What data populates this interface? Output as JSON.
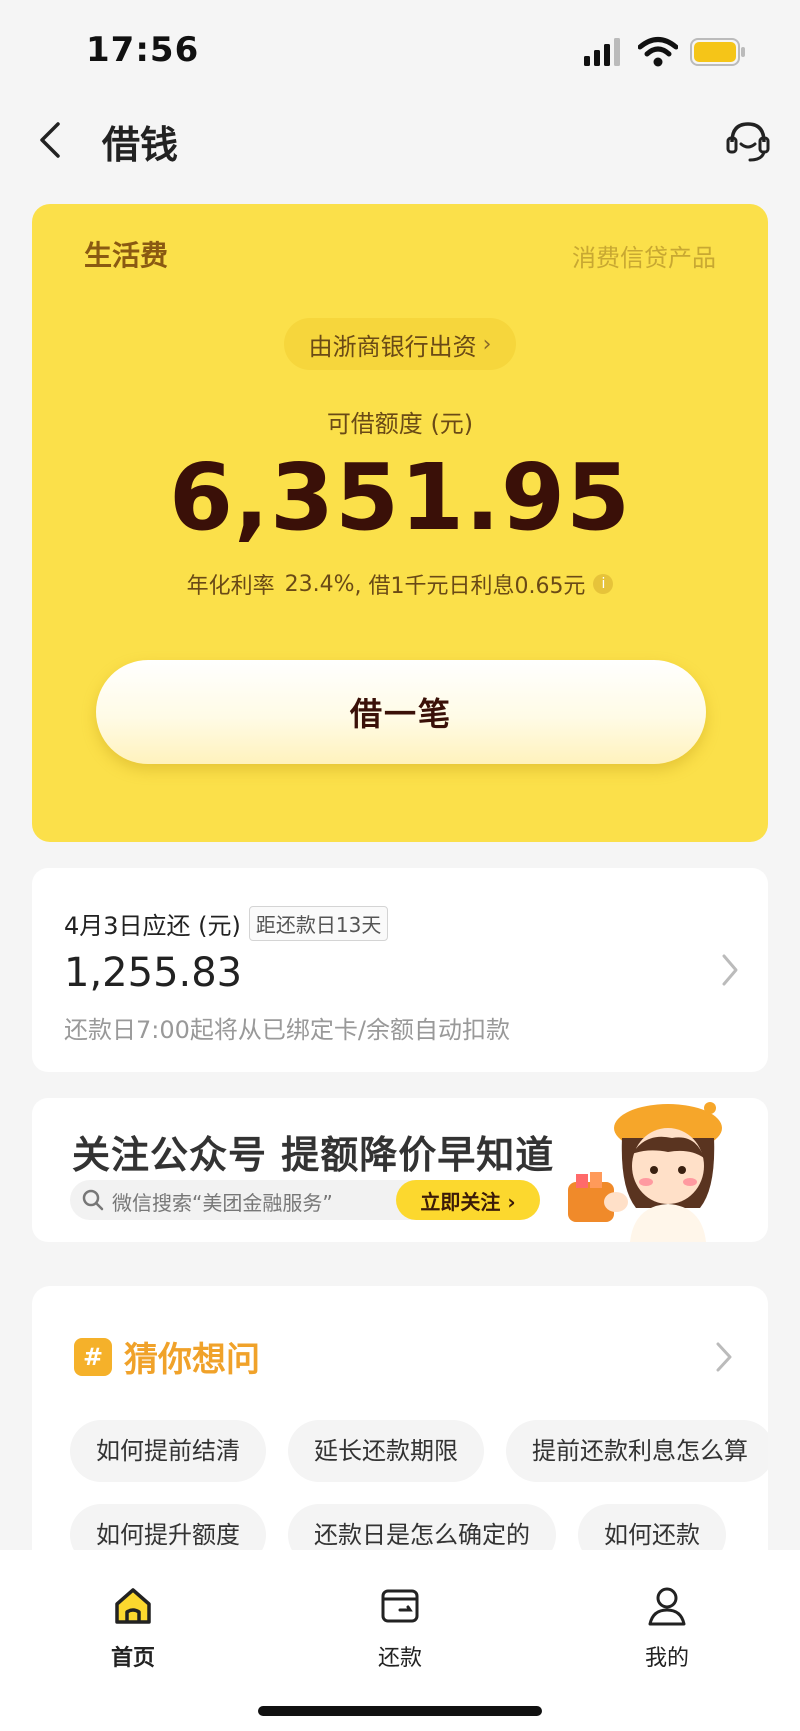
{
  "status_bar": {
    "time": "17:56"
  },
  "nav": {
    "title": "借钱"
  },
  "loan_card": {
    "product_name": "生活费",
    "product_type": "消费信贷产品",
    "bank_text": "由浙商银行出资",
    "limit_label": "可借额度 (元)",
    "limit_amount": "6,351.95",
    "rate_label": "年化利率",
    "rate_value": "23.4%",
    "rate_suffix": ", 借1千元日利息0.65元",
    "borrow_button": "借一笔"
  },
  "repayment": {
    "label": "4月3日应还 (元)",
    "due_badge": "距还款日13天",
    "amount": "1,255.83",
    "note": "还款日7:00起将从已绑定卡/余额自动扣款"
  },
  "banner": {
    "title": "关注公众号 提额降价早知道",
    "search_text": "微信搜索“美团金融服务”",
    "follow_button": "立即关注 ›"
  },
  "faq": {
    "icon_text": "#",
    "title": "猜你想问",
    "row1": [
      "如何提前结清",
      "延长还款期限",
      "提前还款利息怎么算"
    ],
    "row2": [
      "如何提升额度",
      "还款日是怎么确定的",
      "如何还款"
    ]
  },
  "tabbar": {
    "tabs": [
      {
        "label": "首页"
      },
      {
        "label": "还款"
      },
      {
        "label": "我的"
      }
    ]
  },
  "colors": {
    "accent_yellow": "#fbe04a",
    "amount_dark": "#3a1008",
    "faq_orange": "#f0a22a"
  },
  "icons": [
    "back-icon",
    "customer-service-icon",
    "chevron-right-icon",
    "search-icon",
    "home-icon",
    "repay-icon",
    "profile-icon"
  ]
}
